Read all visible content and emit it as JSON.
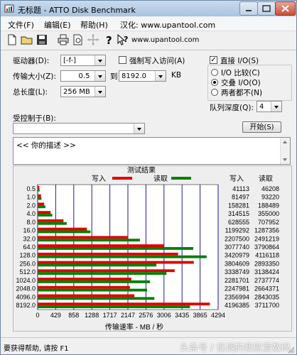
{
  "window": {
    "title": "无标题 - ATTO Disk Benchmark"
  },
  "menu": [
    {
      "label": "文件(F)"
    },
    {
      "label": "编辑(E)"
    },
    {
      "label": "帮助(H)"
    },
    {
      "label": "汉化: www.upantool.com"
    }
  ],
  "toolbar": {
    "url": "www.upantool.com",
    "icons": [
      "new-file-icon",
      "open-folder-icon",
      "save-icon",
      "print-icon",
      "print-preview-icon",
      "move-icon",
      "help-icon",
      "context-help-icon"
    ]
  },
  "settings": {
    "drive": {
      "label": "驱动器(D):",
      "value": "[-f-]"
    },
    "transfer": {
      "label": "传输大小(Z):",
      "from": "0.5",
      "to_label": "到",
      "to": "8192.0",
      "unit": "KB"
    },
    "total": {
      "label": "总长度(L):",
      "value": "256 MB"
    },
    "force_write": {
      "label": "强制写入访问(A)",
      "checked": false
    },
    "direct_io": {
      "label": "直接 I/O(S)",
      "checked": true
    },
    "io_mode": {
      "options": [
        {
          "label": "I/O 比较(C)",
          "selected": false
        },
        {
          "label": "交叠 I/O(O)",
          "selected": true
        },
        {
          "label": "两者都不(N)",
          "selected": false
        }
      ]
    },
    "queue": {
      "label": "队列深度(Q):",
      "value": "4"
    },
    "controlled": {
      "label": "受控制于(B):",
      "value": ""
    },
    "start_button": "开始(S)",
    "description": "<<    你的描述    >>"
  },
  "results": {
    "title": "测试结果",
    "legend_write": "写入",
    "legend_read": "读取",
    "col_write": "写入",
    "col_read": "读取",
    "axis_label": "传输速率 - MB / 秒",
    "write_color": "#e00000",
    "read_color": "#008000",
    "grid_color": "#1f1f8f"
  },
  "chart_data": {
    "type": "bar",
    "orientation": "horizontal",
    "title": "测试结果",
    "xlabel": "传输速率 - MB / 秒",
    "xlim": [
      0,
      4294
    ],
    "xticks": [
      "0",
      "429",
      "858",
      "1288",
      "1717",
      "2147",
      "2576",
      "3006",
      "3435",
      "3865",
      "4294"
    ],
    "categories": [
      "0.5",
      "1.0",
      "2.0",
      "4.0",
      "8.0",
      "16.0",
      "32.0",
      "64.0",
      "128.0",
      "256.0",
      "512.0",
      "1024.0",
      "2048.0",
      "4096.0",
      "8192.0"
    ],
    "series": [
      {
        "name": "写入",
        "values": [
          41113,
          81497,
          158281,
          314515,
          628555,
          1199292,
          2207500,
          3077740,
          3420979,
          3804609,
          3338749,
          2281701,
          2247981,
          2356994,
          4196385
        ]
      },
      {
        "name": "读取",
        "values": [
          46208,
          93220,
          188489,
          355000,
          707952,
          1287356,
          2491219,
          3790864,
          4116118,
          2893350,
          3138424,
          2737774,
          2664371,
          2843035,
          3711700
        ]
      }
    ],
    "value_unit_note": "KB/s"
  },
  "status": {
    "text": "要获得帮助, 请按 F1"
  },
  "watermark": "头条号 / 低调的我就爱数码"
}
